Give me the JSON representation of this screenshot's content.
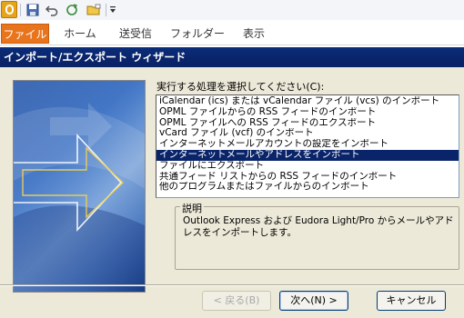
{
  "quick_access": {
    "icons": [
      "office-logo-icon",
      "save-icon",
      "undo-icon",
      "redo-icon",
      "folder-icon",
      "customize-dropdown-icon"
    ]
  },
  "ribbon": {
    "tabs": [
      {
        "label": "ファイル",
        "active": true
      },
      {
        "label": "ホーム",
        "active": false
      },
      {
        "label": "送受信",
        "active": false
      },
      {
        "label": "フォルダー",
        "active": false
      },
      {
        "label": "表示",
        "active": false
      }
    ]
  },
  "wizard": {
    "title": "インポート/エクスポート ウィザード",
    "prompt": "実行する処理を選択してください(C):",
    "options": [
      "iCalendar (ics) または vCalendar ファイル (vcs) のインポート",
      "OPML ファイルからの RSS フィードのインポート",
      "OPML ファイルへの RSS フィードのエクスポート",
      "vCard ファイル (vcf) のインポート",
      "インターネットメールアカウントの設定をインポート",
      "インターネットメールやアドレスをインポート",
      "ファイルにエクスポート",
      "共通フィード リストからの RSS フィードのインポート",
      "他のプログラムまたはファイルからのインポート"
    ],
    "selected_option": "インターネットメールやアドレスをインポート",
    "description_label": "説明",
    "description_text": "Outlook Express および Eudora Light/Pro からメールやアドレスをインポートします。",
    "buttons": {
      "back": "< 戻る(B)",
      "next": "次へ(N) >",
      "cancel": "キャンセル"
    },
    "colors": {
      "title_bar": "#0a246a",
      "selection": "#0a246a",
      "active_tab": "#e8741c",
      "dialog_face": "#ece9d8"
    }
  }
}
